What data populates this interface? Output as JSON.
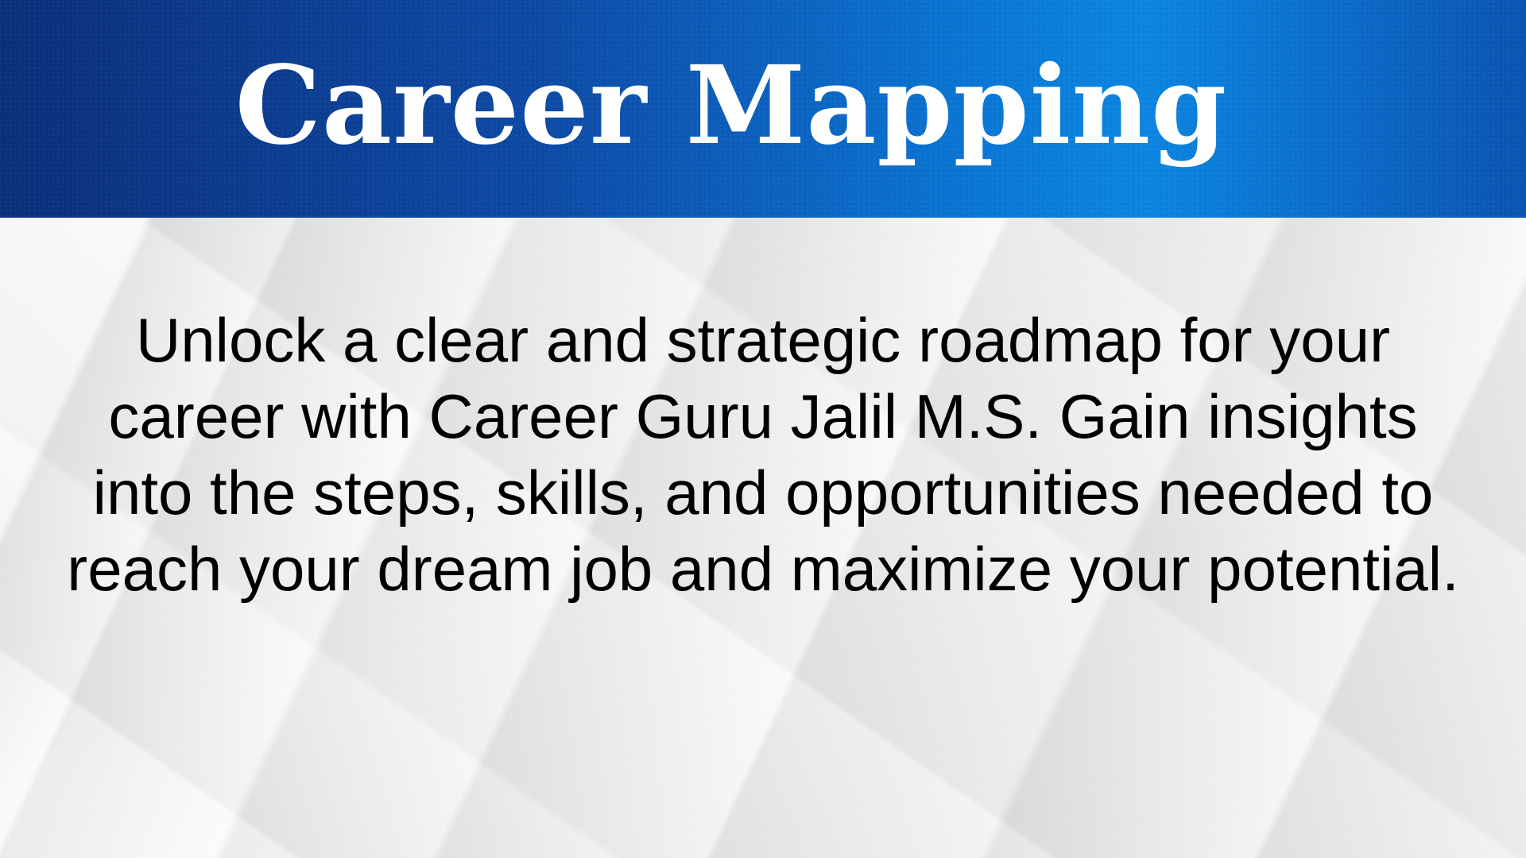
{
  "header": {
    "title": "Career Mapping",
    "colors": {
      "band_left": "#0b2f7a",
      "band_mid": "#0a78d6",
      "band_right": "#0b54b2",
      "title_text": "#ffffff"
    }
  },
  "main": {
    "description": "Unlock a clear and strategic roadmap for your career with Career Guru Jalil M.S. Gain insights into the steps, skills, and opportunities needed to reach your dream job and maximize your potential.",
    "colors": {
      "background": "#ececec",
      "text": "#000000"
    }
  }
}
